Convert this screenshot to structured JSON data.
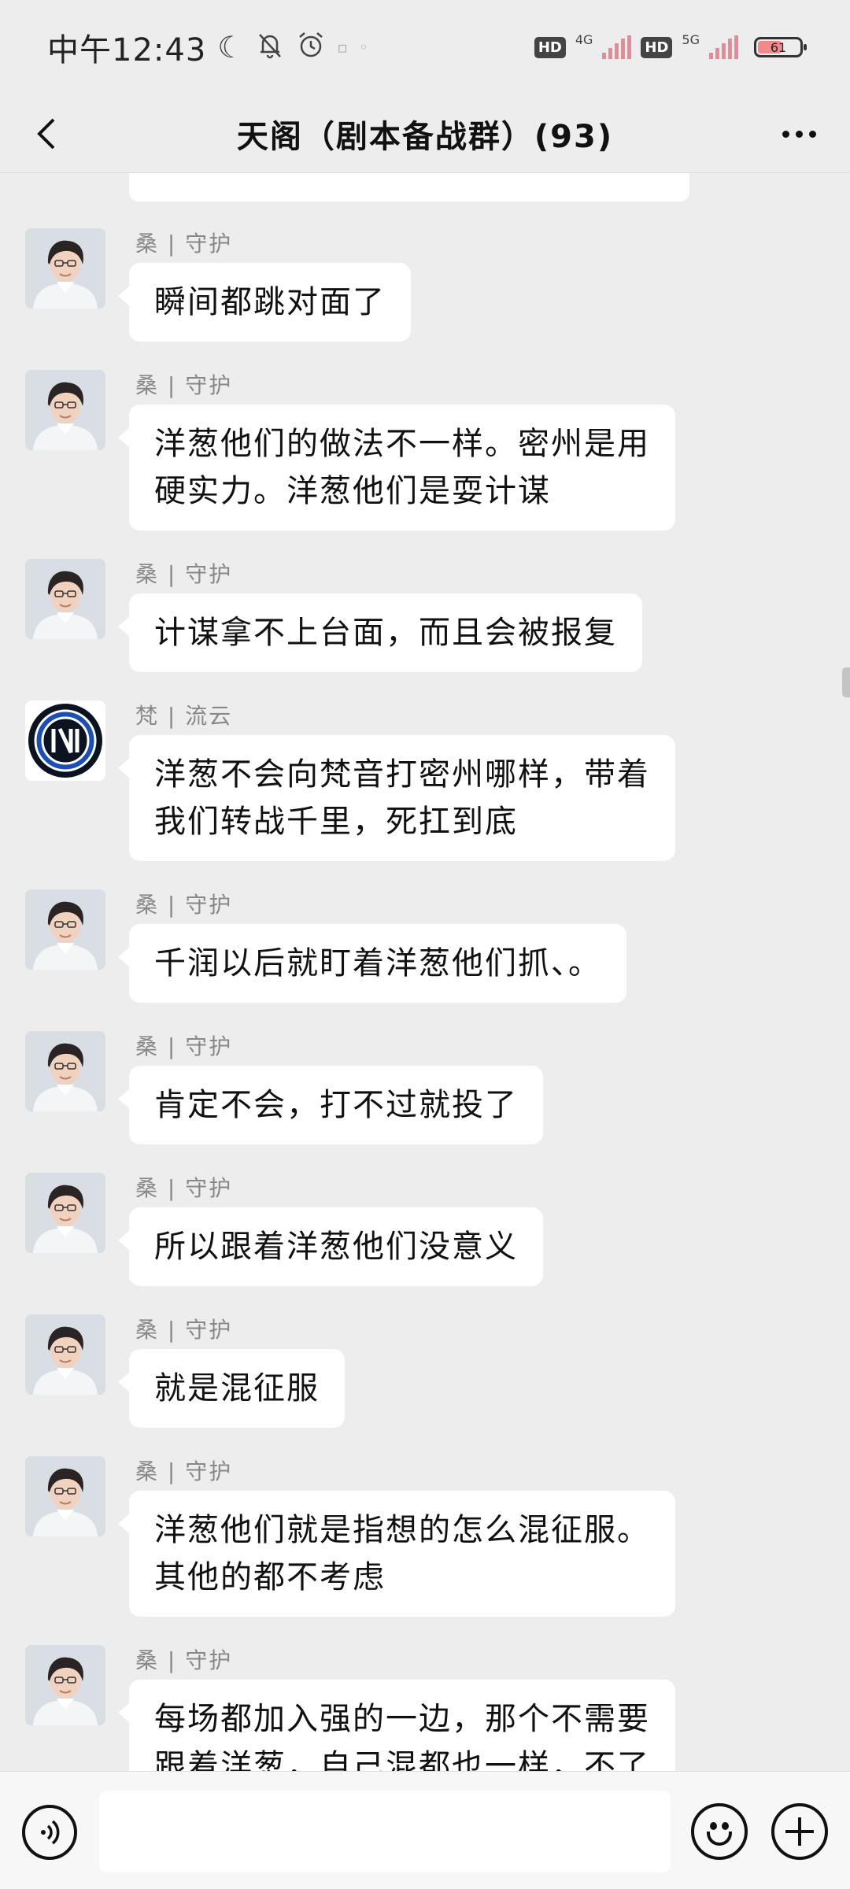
{
  "status_bar": {
    "time": "中午12:43",
    "icons": [
      "moon-icon",
      "bell-off-icon",
      "alarm-icon",
      "image-icon",
      "cloud-icon"
    ],
    "hd1": "HD",
    "net1": "4G",
    "hd2": "HD",
    "net2": "5G",
    "battery": "61"
  },
  "nav": {
    "back_icon": "chevron-left-icon",
    "title": "天阁（剧本备战群）(93)",
    "more_icon": "more-horizontal-icon"
  },
  "messages": [
    {
      "sender": "桑 | 守护",
      "avatar": "user-photo",
      "lines": [
        "瞬间都跳对面了"
      ]
    },
    {
      "sender": "桑 | 守护",
      "avatar": "user-photo",
      "lines": [
        "洋葱他们的做法不一样。密州是用",
        "硬实力。洋葱他们是耍计谋"
      ]
    },
    {
      "sender": "桑 | 守护",
      "avatar": "user-photo",
      "lines": [
        "计谋拿不上台面，而且会被报复"
      ]
    },
    {
      "sender": "梵 | 流云",
      "avatar": "inter-logo",
      "lines": [
        "洋葱不会向梵音打密州哪样，带着",
        "我们转战千里，死扛到底"
      ]
    },
    {
      "sender": "桑 | 守护",
      "avatar": "user-photo",
      "lines": [
        "千润以后就盯着洋葱他们抓、。"
      ]
    },
    {
      "sender": "桑 | 守护",
      "avatar": "user-photo",
      "lines": [
        "肯定不会，打不过就投了"
      ]
    },
    {
      "sender": "桑 | 守护",
      "avatar": "user-photo",
      "lines": [
        "所以跟着洋葱他们没意义"
      ]
    },
    {
      "sender": "桑 | 守护",
      "avatar": "user-photo",
      "lines": [
        "就是混征服"
      ]
    },
    {
      "sender": "桑 | 守护",
      "avatar": "user-photo",
      "lines": [
        "洋葱他们就是指想的怎么混征服。",
        "其他的都不考虑"
      ]
    },
    {
      "sender": "桑 | 守护",
      "avatar": "user-photo",
      "lines": [
        "每场都加入强的一边，那个不需要",
        "跟着洋葱，自己混都也一样，不了"
      ]
    }
  ],
  "input_bar": {
    "voice_icon": "voice-icon",
    "input_value": "",
    "emoji_icon": "emoji-icon",
    "plus_icon": "plus-icon"
  }
}
